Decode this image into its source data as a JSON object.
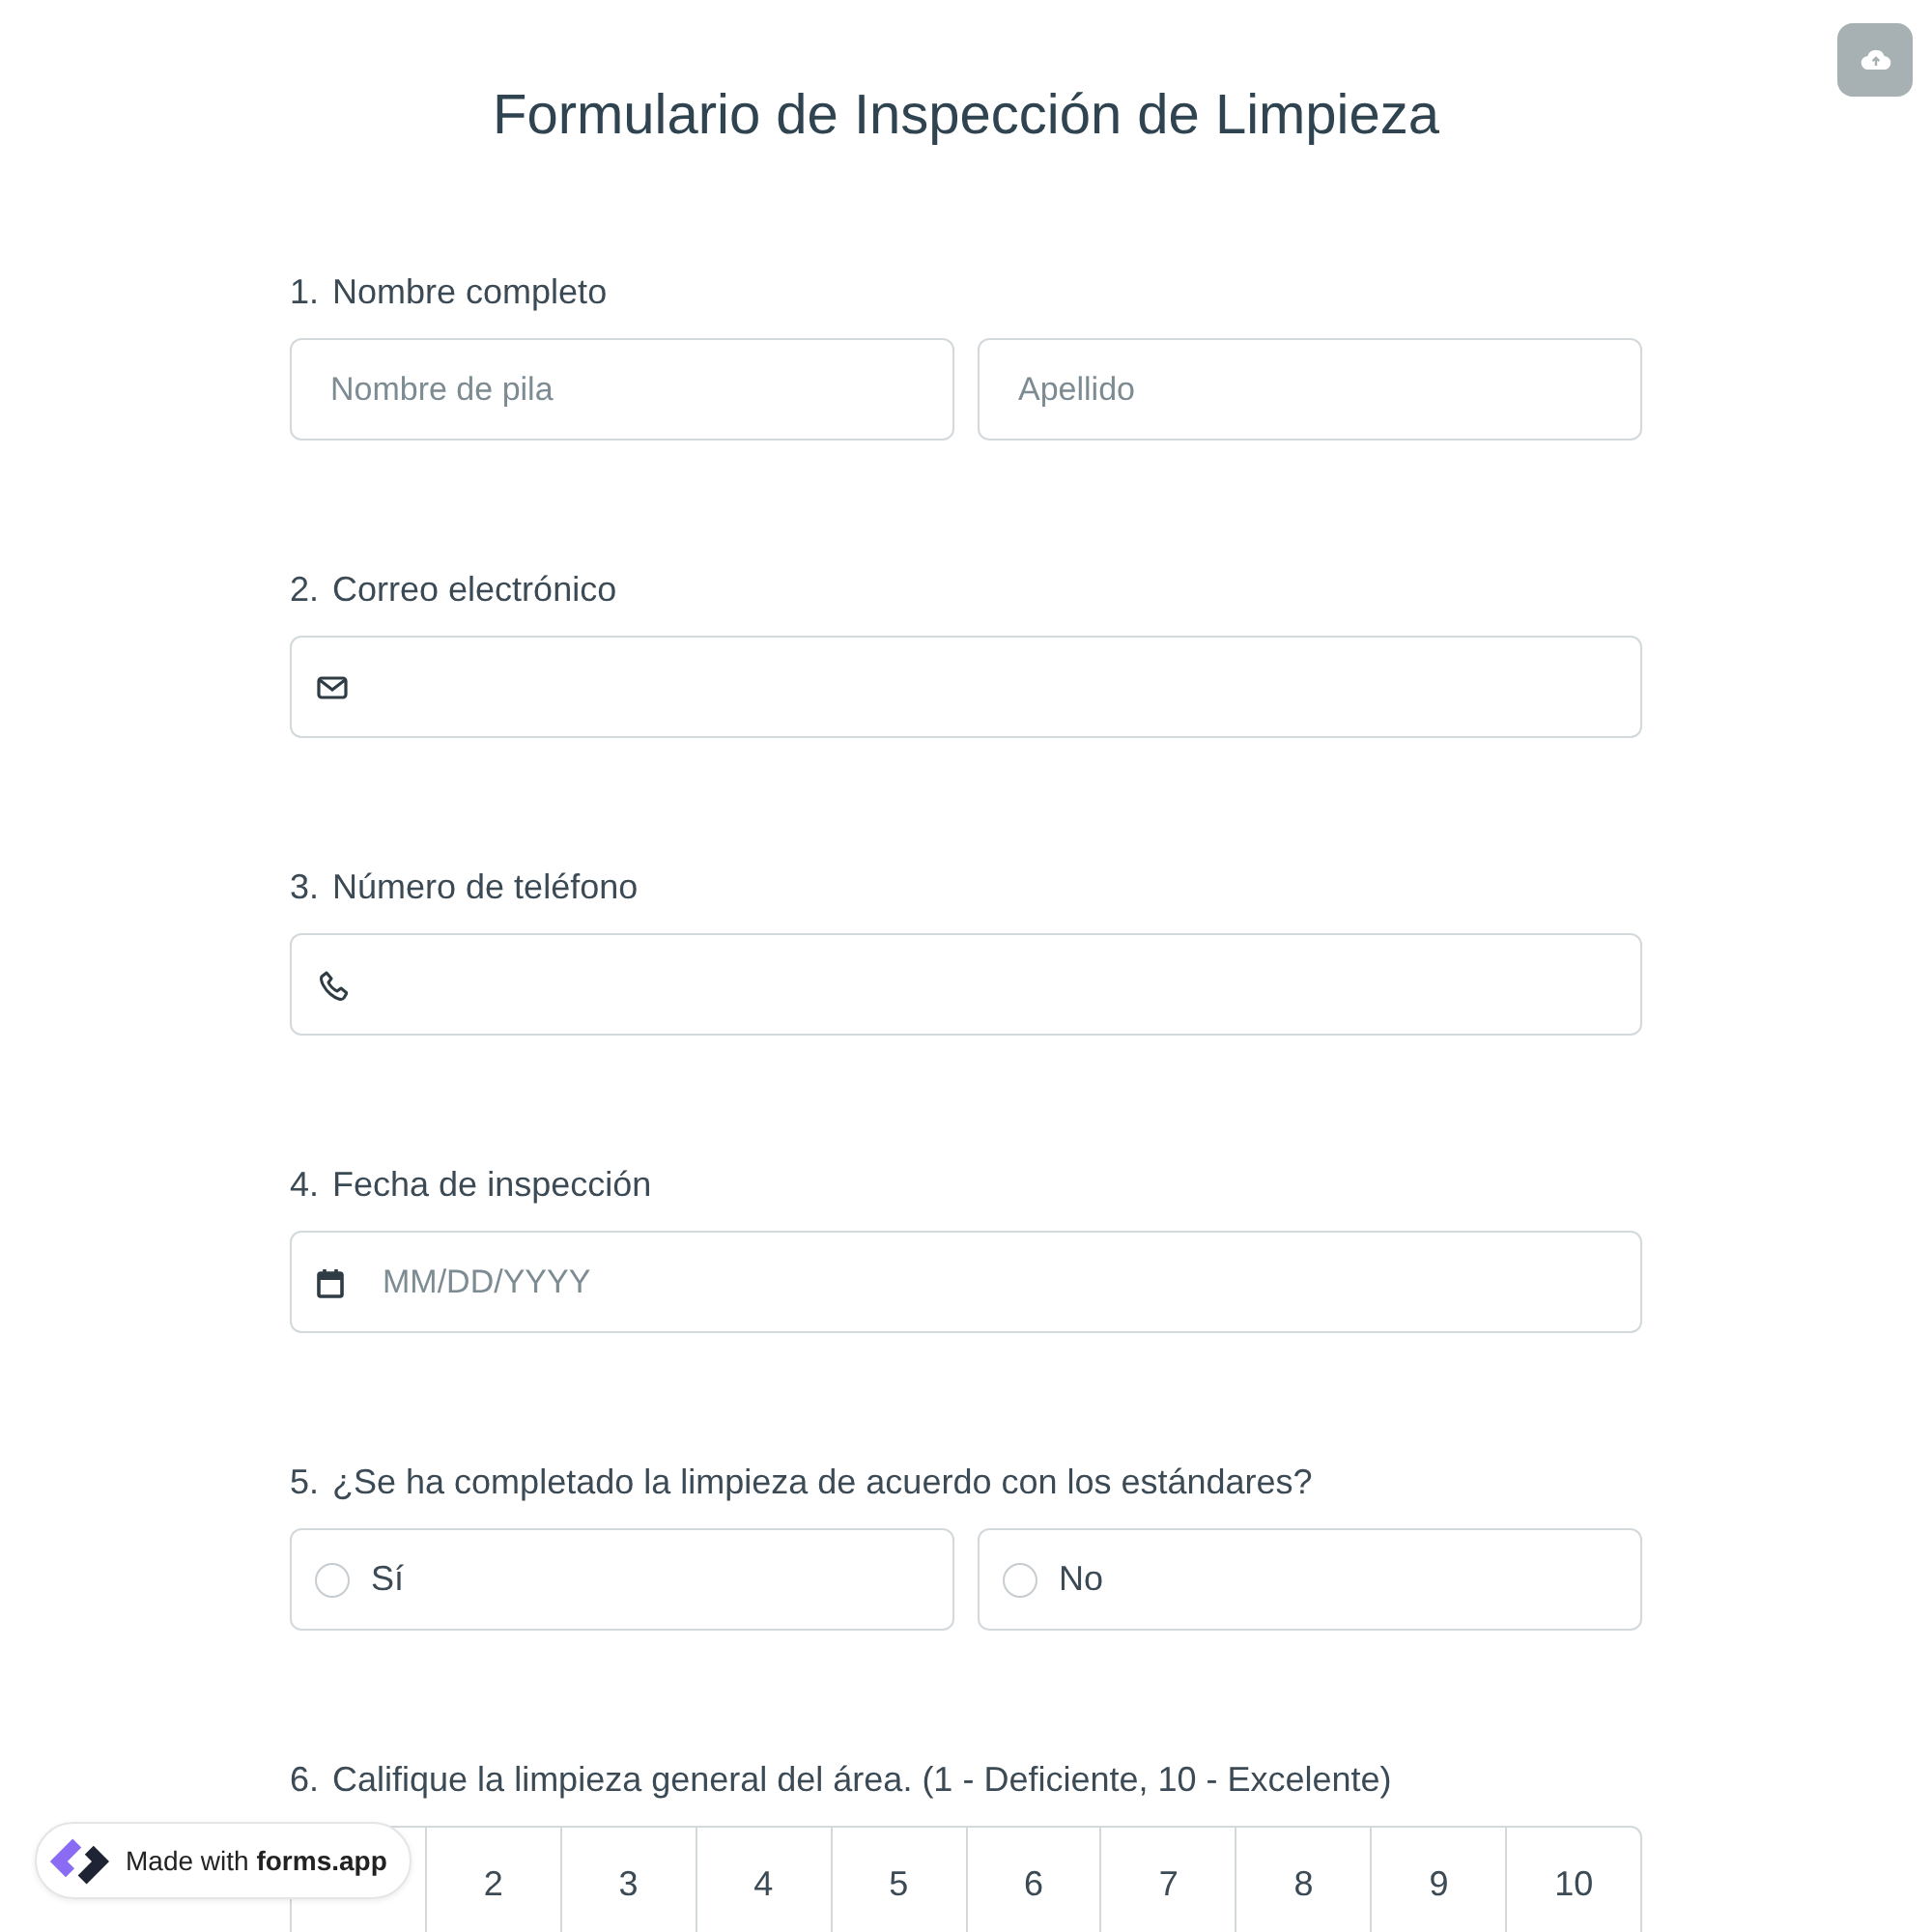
{
  "title": "Formulario de Inspección de Limpieza",
  "questions": [
    {
      "number": "1.",
      "label": "Nombre completo",
      "kind": "name",
      "fields": [
        {
          "placeholder": "Nombre de pila"
        },
        {
          "placeholder": "Apellido"
        }
      ]
    },
    {
      "number": "2.",
      "label": "Correo electrónico",
      "kind": "email"
    },
    {
      "number": "3.",
      "label": "Número de teléfono",
      "kind": "phone"
    },
    {
      "number": "4.",
      "label": "Fecha de inspección",
      "kind": "date",
      "placeholder": "MM/DD/YYYY"
    },
    {
      "number": "5.",
      "label": "¿Se ha completado la limpieza de acuerdo con los estándares?",
      "kind": "choice",
      "options": [
        {
          "label": "Sí",
          "selected": false
        },
        {
          "label": "No",
          "selected": false
        }
      ]
    },
    {
      "number": "6.",
      "label": "Califique la limpieza general del área. (1 - Deficiente, 10 - Excelente)",
      "kind": "rating",
      "options": [
        {
          "selected": false
        },
        {
          "label": "2",
          "selected": false
        },
        {
          "label": "3",
          "selected": false
        },
        {
          "label": "4",
          "selected": false
        },
        {
          "label": "5",
          "selected": false
        },
        {
          "label": "6",
          "selected": false
        },
        {
          "label": "7",
          "selected": false
        },
        {
          "label": "8",
          "selected": false
        },
        {
          "label": "9",
          "selected": false
        },
        {
          "label": "10",
          "selected": false
        }
      ]
    }
  ],
  "badge": {
    "text": "Made with **forms.app**"
  }
}
